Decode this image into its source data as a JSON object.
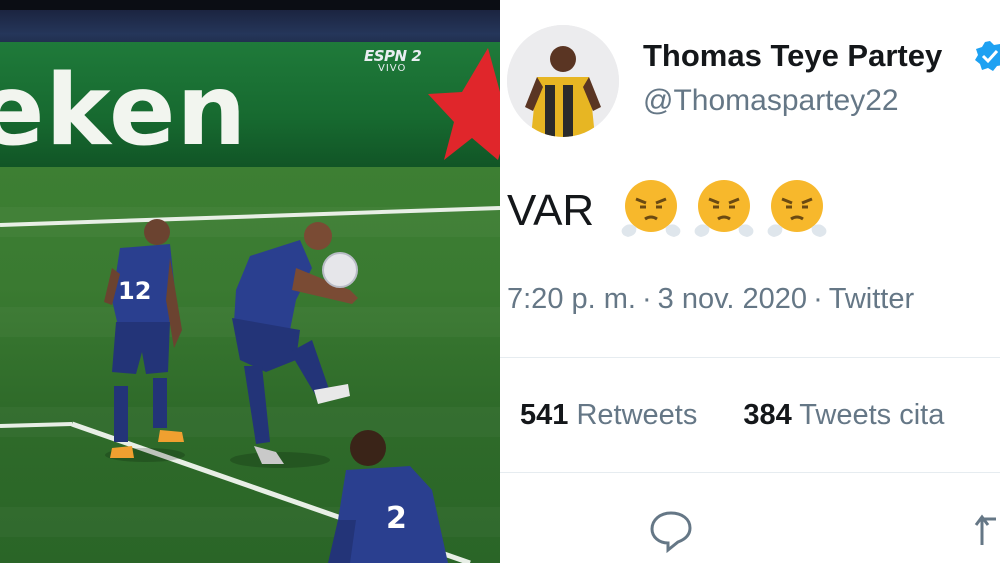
{
  "broadcast": {
    "board_text": "eken",
    "tv_logo": "ESPN 2",
    "tv_sub": "VIVO",
    "player_numbers": [
      "12",
      "2"
    ],
    "colors": {
      "pitch": "#3a7a31",
      "board": "#1f7a3a",
      "kit": "#2a3f8f",
      "star": "#e0262b"
    }
  },
  "tweet": {
    "display_name": "Thomas Teye Partey",
    "handle": "@Thomaspartey22",
    "text": "VAR",
    "emojis": [
      "face-with-steam-from-nose",
      "face-with-steam-from-nose",
      "face-with-steam-from-nose"
    ],
    "time": "7:20 p. m.",
    "date": "3 nov. 2020",
    "source": "Twitter",
    "separator": "·",
    "retweets_count": "541",
    "retweets_label": "Retweets",
    "quotes_count": "384",
    "quotes_label": "Tweets cita",
    "icons": [
      "reply-icon",
      "retweet-icon",
      "verified-badge-icon"
    ],
    "colors": {
      "text": "#14171a",
      "secondary": "#657786",
      "verified": "#1da1f2",
      "divider": "#e6ecf0"
    }
  }
}
